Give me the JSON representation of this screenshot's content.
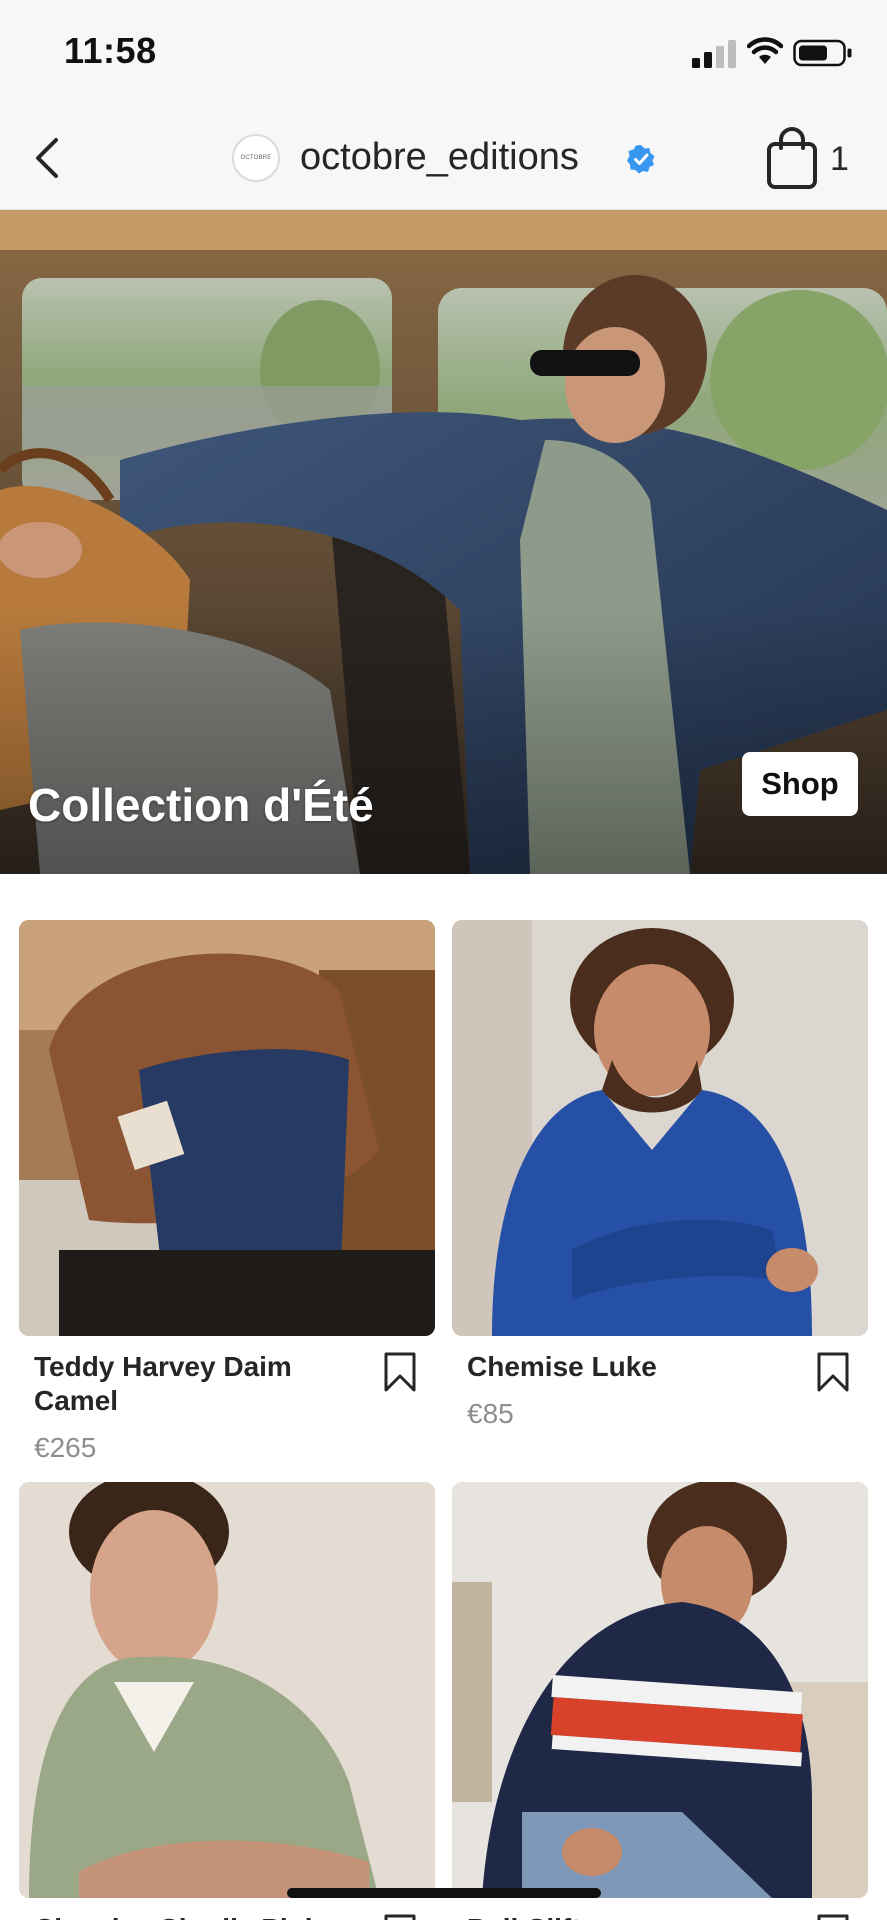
{
  "status_bar": {
    "time": "11:58"
  },
  "header": {
    "brand_name": "octobre_editions",
    "avatar_text": "OCTOBRE",
    "cart_count": "1"
  },
  "hero": {
    "title": "Collection d'Été",
    "shop_label": "Shop"
  },
  "products": [
    {
      "name": "Teddy Harvey Daim Camel",
      "price": "€265"
    },
    {
      "name": "Chemise Luke",
      "price": "€85"
    },
    {
      "name": "Chemise Charlie Pink",
      "price": ""
    },
    {
      "name": "Pull Clift",
      "price": ""
    }
  ],
  "colors": {
    "accent_verified": "#3897f0",
    "text": "#262626",
    "muted": "#8e8e8e"
  }
}
